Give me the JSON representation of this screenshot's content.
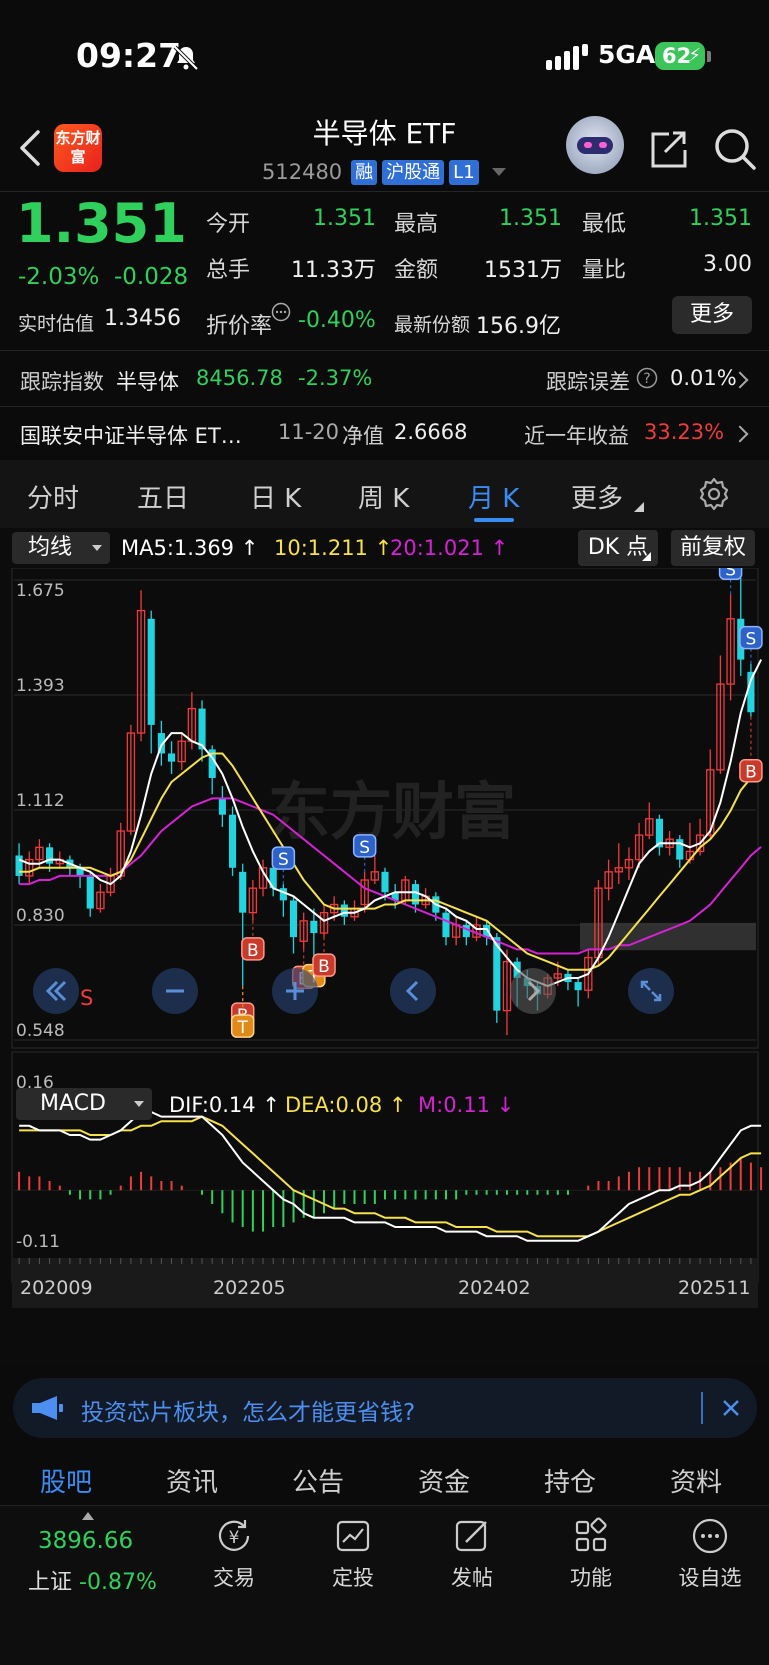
{
  "status_bar": {
    "time": "09:27",
    "network": "5GA",
    "battery": "62"
  },
  "header": {
    "logo_text": "东方财富",
    "title": "半导体 ETF",
    "code": "512480",
    "tags": [
      "融",
      "沪股通",
      "L1"
    ]
  },
  "quote": {
    "price": "1.351",
    "change_pct": "-2.03%",
    "change_abs": "-0.028",
    "labels": {
      "open": "今开",
      "high": "最高",
      "low": "最低",
      "volume": "总手",
      "amount": "金额",
      "volume_ratio": "量比",
      "iopv": "实时估值",
      "discount": "折价率",
      "shares": "最新份额"
    },
    "values": {
      "open": "1.351",
      "high": "1.351",
      "low": "1.351",
      "volume": "11.33万",
      "amount": "1531万",
      "volume_ratio": "3.00",
      "iopv": "1.3456",
      "discount": "-0.40%",
      "shares": "156.9亿"
    },
    "more_button": "更多"
  },
  "tracking": {
    "label": "跟踪指数",
    "index_name": "半导体",
    "index_value": "8456.78",
    "index_change": "-2.37%",
    "error_label": "跟踪误差",
    "error_value": "0.01%"
  },
  "fund": {
    "name": "国联安中证半导体 ET…",
    "date": "11-20",
    "nav_label": "净值",
    "nav_value": "2.6668",
    "return_label": "近一年收益",
    "return_value": "33.23%"
  },
  "chart_tabs": [
    "分时",
    "五日",
    "日 K",
    "周 K",
    "月 K",
    "更多"
  ],
  "active_chart_tab": "月 K",
  "indicator_bar": {
    "select": "均线",
    "ma5": "MA5:1.369 ↑",
    "ma10": "10:1.211 ↑",
    "ma20": "20:1.021 ↑",
    "dk_button": "DK 点",
    "adjust_button": "前复权"
  },
  "colors": {
    "up": "#f03b3b",
    "down": "#22d3e0",
    "ma5": "#ffffff",
    "ma10": "#f5e14a",
    "ma20": "#d422d4",
    "accent": "#3a8cf5",
    "green": "#2fd05b"
  },
  "chart_data": [
    {
      "type": "candlestick",
      "y_ticks": [
        "1.675",
        "1.393",
        "1.112",
        "0.830",
        "0.548"
      ],
      "ylim": [
        0.548,
        1.675
      ],
      "watermark": "东方财富",
      "candles": [
        {
          "o": 1.0,
          "c": 0.95,
          "h": 1.03,
          "l": 0.93
        },
        {
          "o": 0.95,
          "c": 0.99,
          "h": 1.01,
          "l": 0.93
        },
        {
          "o": 0.99,
          "c": 1.02,
          "h": 1.04,
          "l": 0.97
        },
        {
          "o": 1.02,
          "c": 0.98,
          "h": 1.03,
          "l": 0.96
        },
        {
          "o": 0.98,
          "c": 0.99,
          "h": 1.01,
          "l": 0.97
        },
        {
          "o": 0.99,
          "c": 0.97,
          "h": 1.0,
          "l": 0.95
        },
        {
          "o": 0.97,
          "c": 0.95,
          "h": 0.98,
          "l": 0.92
        },
        {
          "o": 0.95,
          "c": 0.87,
          "h": 0.96,
          "l": 0.85
        },
        {
          "o": 0.87,
          "c": 0.91,
          "h": 0.93,
          "l": 0.86
        },
        {
          "o": 0.91,
          "c": 0.95,
          "h": 0.97,
          "l": 0.9
        },
        {
          "o": 0.95,
          "c": 1.06,
          "h": 1.08,
          "l": 0.94
        },
        {
          "o": 1.06,
          "c": 1.3,
          "h": 1.32,
          "l": 1.05
        },
        {
          "o": 1.3,
          "c": 1.6,
          "h": 1.65,
          "l": 1.28
        },
        {
          "o": 1.58,
          "c": 1.32,
          "h": 1.6,
          "l": 1.25
        },
        {
          "o": 1.3,
          "c": 1.25,
          "h": 1.33,
          "l": 1.22
        },
        {
          "o": 1.25,
          "c": 1.23,
          "h": 1.28,
          "l": 1.2
        },
        {
          "o": 1.23,
          "c": 1.28,
          "h": 1.3,
          "l": 1.21
        },
        {
          "o": 1.28,
          "c": 1.36,
          "h": 1.4,
          "l": 1.26
        },
        {
          "o": 1.36,
          "c": 1.26,
          "h": 1.38,
          "l": 1.23
        },
        {
          "o": 1.26,
          "c": 1.19,
          "h": 1.27,
          "l": 1.15
        },
        {
          "o": 1.14,
          "c": 1.1,
          "h": 1.17,
          "l": 1.07
        },
        {
          "o": 1.1,
          "c": 0.97,
          "h": 1.12,
          "l": 0.95
        },
        {
          "o": 0.96,
          "c": 0.86,
          "h": 0.98,
          "l": 0.68
        },
        {
          "o": 0.86,
          "c": 0.92,
          "h": 0.94,
          "l": 0.84
        },
        {
          "o": 0.92,
          "c": 0.97,
          "h": 0.99,
          "l": 0.9
        },
        {
          "o": 0.97,
          "c": 0.92,
          "h": 0.98,
          "l": 0.9
        },
        {
          "o": 0.92,
          "c": 0.89,
          "h": 0.93,
          "l": 0.85
        },
        {
          "o": 0.89,
          "c": 0.8,
          "h": 0.9,
          "l": 0.76
        },
        {
          "o": 0.79,
          "c": 0.84,
          "h": 0.86,
          "l": 0.77
        },
        {
          "o": 0.84,
          "c": 0.81,
          "h": 0.87,
          "l": 0.74
        },
        {
          "o": 0.81,
          "c": 0.86,
          "h": 0.88,
          "l": 0.8
        },
        {
          "o": 0.86,
          "c": 0.88,
          "h": 0.9,
          "l": 0.84
        },
        {
          "o": 0.88,
          "c": 0.85,
          "h": 0.89,
          "l": 0.83
        },
        {
          "o": 0.85,
          "c": 0.87,
          "h": 0.89,
          "l": 0.84
        },
        {
          "o": 0.88,
          "c": 0.94,
          "h": 0.96,
          "l": 0.86
        },
        {
          "o": 0.94,
          "c": 0.96,
          "h": 1.0,
          "l": 0.93
        },
        {
          "o": 0.96,
          "c": 0.91,
          "h": 0.97,
          "l": 0.89
        },
        {
          "o": 0.91,
          "c": 0.89,
          "h": 0.93,
          "l": 0.87
        },
        {
          "o": 0.89,
          "c": 0.94,
          "h": 0.95,
          "l": 0.88
        },
        {
          "o": 0.93,
          "c": 0.88,
          "h": 0.94,
          "l": 0.86
        },
        {
          "o": 0.88,
          "c": 0.9,
          "h": 0.92,
          "l": 0.87
        },
        {
          "o": 0.9,
          "c": 0.86,
          "h": 0.91,
          "l": 0.84
        },
        {
          "o": 0.86,
          "c": 0.8,
          "h": 0.87,
          "l": 0.78
        },
        {
          "o": 0.8,
          "c": 0.83,
          "h": 0.85,
          "l": 0.78
        },
        {
          "o": 0.83,
          "c": 0.8,
          "h": 0.84,
          "l": 0.78
        },
        {
          "o": 0.8,
          "c": 0.83,
          "h": 0.85,
          "l": 0.79
        },
        {
          "o": 0.83,
          "c": 0.8,
          "h": 0.84,
          "l": 0.78
        },
        {
          "o": 0.8,
          "c": 0.62,
          "h": 0.81,
          "l": 0.59
        },
        {
          "o": 0.62,
          "c": 0.74,
          "h": 0.77,
          "l": 0.56
        },
        {
          "o": 0.74,
          "c": 0.7,
          "h": 0.75,
          "l": 0.63
        },
        {
          "o": 0.7,
          "c": 0.68,
          "h": 0.72,
          "l": 0.65
        },
        {
          "o": 0.68,
          "c": 0.66,
          "h": 0.69,
          "l": 0.62
        },
        {
          "o": 0.66,
          "c": 0.7,
          "h": 0.71,
          "l": 0.65
        },
        {
          "o": 0.7,
          "c": 0.71,
          "h": 0.74,
          "l": 0.68
        },
        {
          "o": 0.71,
          "c": 0.69,
          "h": 0.72,
          "l": 0.67
        },
        {
          "o": 0.69,
          "c": 0.67,
          "h": 0.7,
          "l": 0.63
        },
        {
          "o": 0.67,
          "c": 0.75,
          "h": 0.77,
          "l": 0.65
        },
        {
          "o": 0.75,
          "c": 0.92,
          "h": 0.94,
          "l": 0.73
        },
        {
          "o": 0.92,
          "c": 0.96,
          "h": 0.99,
          "l": 0.89
        },
        {
          "o": 0.96,
          "c": 0.97,
          "h": 1.03,
          "l": 0.93
        },
        {
          "o": 0.97,
          "c": 0.99,
          "h": 1.02,
          "l": 0.94
        },
        {
          "o": 0.99,
          "c": 1.05,
          "h": 1.08,
          "l": 0.97
        },
        {
          "o": 1.05,
          "c": 1.09,
          "h": 1.13,
          "l": 1.04
        },
        {
          "o": 1.09,
          "c": 1.02,
          "h": 1.1,
          "l": 1.0
        },
        {
          "o": 1.02,
          "c": 1.04,
          "h": 1.06,
          "l": 1.0
        },
        {
          "o": 1.04,
          "c": 0.99,
          "h": 1.05,
          "l": 0.97
        },
        {
          "o": 0.99,
          "c": 1.01,
          "h": 1.08,
          "l": 0.98
        },
        {
          "o": 1.01,
          "c": 1.05,
          "h": 1.09,
          "l": 1.0
        },
        {
          "o": 1.05,
          "c": 1.21,
          "h": 1.26,
          "l": 1.04
        },
        {
          "o": 1.21,
          "c": 1.42,
          "h": 1.49,
          "l": 1.2
        },
        {
          "o": 1.42,
          "c": 1.58,
          "h": 1.64,
          "l": 1.38
        },
        {
          "o": 1.58,
          "c": 1.48,
          "h": 1.68,
          "l": 1.44
        },
        {
          "o": 1.45,
          "c": 1.351,
          "h": 1.47,
          "l": 1.34
        }
      ],
      "ma5": [
        0.99,
        0.98,
        0.98,
        0.99,
        0.99,
        0.98,
        0.97,
        0.96,
        0.94,
        0.93,
        0.95,
        1.01,
        1.1,
        1.2,
        1.27,
        1.3,
        1.3,
        1.28,
        1.27,
        1.24,
        1.2,
        1.14,
        1.07,
        1.01,
        0.96,
        0.92,
        0.91,
        0.9,
        0.88,
        0.86,
        0.84,
        0.85,
        0.86,
        0.86,
        0.87,
        0.89,
        0.9,
        0.91,
        0.91,
        0.91,
        0.9,
        0.88,
        0.87,
        0.85,
        0.84,
        0.82,
        0.82,
        0.78,
        0.75,
        0.72,
        0.7,
        0.69,
        0.68,
        0.69,
        0.7,
        0.7,
        0.71,
        0.75,
        0.8,
        0.86,
        0.92,
        0.98,
        1.01,
        1.03,
        1.03,
        1.03,
        1.02,
        1.03,
        1.06,
        1.13,
        1.23,
        1.35,
        1.43,
        1.48
      ],
      "ma10": [
        0.96,
        0.96,
        0.97,
        0.97,
        0.97,
        0.97,
        0.97,
        0.97,
        0.96,
        0.95,
        0.96,
        0.99,
        1.04,
        1.09,
        1.14,
        1.18,
        1.2,
        1.22,
        1.24,
        1.25,
        1.25,
        1.22,
        1.18,
        1.14,
        1.1,
        1.06,
        1.02,
        0.98,
        0.94,
        0.91,
        0.88,
        0.87,
        0.87,
        0.87,
        0.87,
        0.87,
        0.88,
        0.88,
        0.89,
        0.89,
        0.89,
        0.89,
        0.88,
        0.87,
        0.86,
        0.85,
        0.84,
        0.82,
        0.8,
        0.78,
        0.76,
        0.75,
        0.74,
        0.73,
        0.72,
        0.72,
        0.72,
        0.73,
        0.75,
        0.78,
        0.81,
        0.84,
        0.87,
        0.9,
        0.93,
        0.96,
        0.99,
        1.02,
        1.04,
        1.07,
        1.11,
        1.16,
        1.19,
        1.211
      ],
      "ma20": [
        0.93,
        0.93,
        0.94,
        0.94,
        0.95,
        0.95,
        0.95,
        0.95,
        0.95,
        0.95,
        0.96,
        0.98,
        1.0,
        1.03,
        1.06,
        1.08,
        1.1,
        1.12,
        1.13,
        1.14,
        1.14,
        1.14,
        1.13,
        1.12,
        1.11,
        1.1,
        1.08,
        1.06,
        1.04,
        1.02,
        1.0,
        0.98,
        0.96,
        0.94,
        0.92,
        0.91,
        0.9,
        0.89,
        0.88,
        0.87,
        0.86,
        0.85,
        0.84,
        0.83,
        0.82,
        0.81,
        0.8,
        0.79,
        0.78,
        0.77,
        0.77,
        0.76,
        0.76,
        0.76,
        0.76,
        0.76,
        0.77,
        0.77,
        0.77,
        0.78,
        0.78,
        0.79,
        0.8,
        0.81,
        0.82,
        0.83,
        0.84,
        0.86,
        0.88,
        0.91,
        0.94,
        0.97,
        1.0,
        1.021
      ],
      "signals": [
        {
          "i": 22,
          "type": "B"
        },
        {
          "i": 22,
          "type": "T"
        },
        {
          "i": 23,
          "type": "B"
        },
        {
          "i": 26,
          "type": "S"
        },
        {
          "i": 28,
          "type": "B"
        },
        {
          "i": 29,
          "type": "T"
        },
        {
          "i": 30,
          "type": "B"
        },
        {
          "i": 34,
          "type": "S"
        },
        {
          "i": 70,
          "type": "S"
        },
        {
          "i": 72,
          "type": "S"
        },
        {
          "i": 72,
          "type": "B"
        }
      ]
    },
    {
      "type": "bar",
      "name": "MACD",
      "select": "MACD",
      "dif_label": "DIF:0.14 ↑",
      "dea_label": "DEA:0.08 ↑",
      "m_label": "M:0.11 ↓",
      "y_ticks": [
        "0.16",
        "-0.11"
      ],
      "ylim": [
        -0.13,
        0.17
      ],
      "x_ticks": [
        "202009",
        "202205",
        "202402",
        "202511"
      ],
      "dif": [
        0.14,
        0.14,
        0.13,
        0.13,
        0.13,
        0.12,
        0.12,
        0.11,
        0.11,
        0.12,
        0.13,
        0.15,
        0.17,
        0.17,
        0.16,
        0.16,
        0.16,
        0.16,
        0.16,
        0.14,
        0.12,
        0.09,
        0.06,
        0.04,
        0.02,
        0.0,
        -0.02,
        -0.03,
        -0.05,
        -0.06,
        -0.06,
        -0.06,
        -0.06,
        -0.07,
        -0.07,
        -0.07,
        -0.07,
        -0.08,
        -0.08,
        -0.08,
        -0.08,
        -0.08,
        -0.09,
        -0.09,
        -0.09,
        -0.09,
        -0.1,
        -0.1,
        -0.1,
        -0.1,
        -0.11,
        -0.11,
        -0.11,
        -0.11,
        -0.11,
        -0.11,
        -0.1,
        -0.09,
        -0.07,
        -0.05,
        -0.03,
        -0.02,
        -0.01,
        0.0,
        0.0,
        0.01,
        0.01,
        0.02,
        0.04,
        0.07,
        0.1,
        0.13,
        0.14,
        0.14
      ],
      "dea": [
        0.13,
        0.13,
        0.13,
        0.13,
        0.13,
        0.13,
        0.13,
        0.12,
        0.12,
        0.12,
        0.13,
        0.13,
        0.14,
        0.14,
        0.15,
        0.15,
        0.15,
        0.15,
        0.16,
        0.15,
        0.14,
        0.12,
        0.1,
        0.08,
        0.06,
        0.04,
        0.02,
        0.0,
        -0.01,
        -0.02,
        -0.03,
        -0.04,
        -0.04,
        -0.05,
        -0.05,
        -0.05,
        -0.06,
        -0.06,
        -0.06,
        -0.07,
        -0.07,
        -0.07,
        -0.07,
        -0.08,
        -0.08,
        -0.08,
        -0.08,
        -0.09,
        -0.09,
        -0.09,
        -0.09,
        -0.1,
        -0.1,
        -0.1,
        -0.1,
        -0.1,
        -0.1,
        -0.09,
        -0.08,
        -0.07,
        -0.06,
        -0.05,
        -0.04,
        -0.03,
        -0.02,
        -0.01,
        -0.01,
        0.0,
        0.01,
        0.03,
        0.05,
        0.07,
        0.08,
        0.08
      ],
      "hist": [
        0.04,
        0.03,
        0.03,
        0.02,
        0.01,
        -0.01,
        -0.02,
        -0.02,
        -0.02,
        -0.01,
        0.01,
        0.03,
        0.04,
        0.03,
        0.02,
        0.02,
        0.01,
        0.0,
        -0.01,
        -0.03,
        -0.05,
        -0.07,
        -0.08,
        -0.09,
        -0.09,
        -0.08,
        -0.08,
        -0.07,
        -0.06,
        -0.06,
        -0.05,
        -0.04,
        -0.03,
        -0.03,
        -0.03,
        -0.03,
        -0.02,
        -0.02,
        -0.02,
        -0.02,
        -0.02,
        -0.02,
        -0.02,
        -0.02,
        -0.01,
        -0.01,
        -0.01,
        -0.01,
        -0.01,
        -0.01,
        -0.01,
        -0.01,
        -0.01,
        -0.01,
        -0.01,
        0.0,
        0.01,
        0.02,
        0.02,
        0.03,
        0.04,
        0.05,
        0.05,
        0.05,
        0.05,
        0.05,
        0.04,
        0.04,
        0.04,
        0.05,
        0.06,
        0.07,
        0.06,
        0.05
      ]
    }
  ],
  "chart_controls": {
    "s_label": "S"
  },
  "ad_banner": {
    "text": "投资芯片板块，怎么才能更省钱?"
  },
  "bottom_tabs": [
    "股吧",
    "资讯",
    "公告",
    "资金",
    "持仓",
    "资料"
  ],
  "active_bottom_tab": "股吧",
  "footer": {
    "index_value": "3896.66",
    "index_name": "上证",
    "index_change": "-0.87%",
    "items": [
      "交易",
      "定投",
      "发帖",
      "功能",
      "设自选"
    ]
  }
}
